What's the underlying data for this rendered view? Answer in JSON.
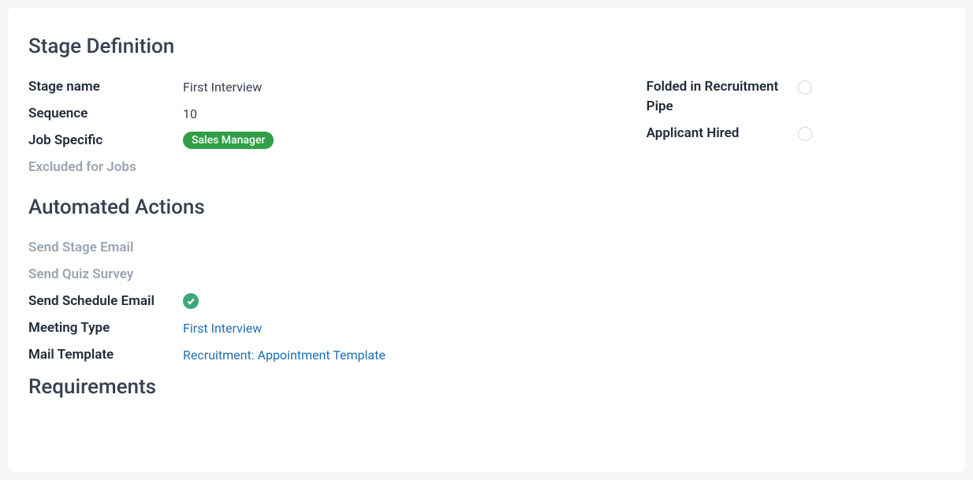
{
  "sections": {
    "stage_definition": {
      "title": "Stage Definition"
    },
    "automated_actions": {
      "title": "Automated Actions"
    },
    "requirements": {
      "title": "Requirements"
    }
  },
  "stage": {
    "name_label": "Stage name",
    "name_value": "First Interview",
    "sequence_label": "Sequence",
    "sequence_value": "10",
    "job_specific_label": "Job Specific",
    "job_specific_tag": "Sales Manager",
    "excluded_jobs_label": "Excluded for Jobs",
    "folded_label": "Folded in Recruitment Pipe",
    "folded_checked": false,
    "hired_label": "Applicant Hired",
    "hired_checked": false
  },
  "automated": {
    "send_stage_email_label": "Send Stage Email",
    "send_quiz_survey_label": "Send Quiz Survey",
    "send_schedule_email_label": "Send Schedule Email",
    "send_schedule_email_checked": true,
    "meeting_type_label": "Meeting Type",
    "meeting_type_value": "First Interview",
    "mail_template_label": "Mail Template",
    "mail_template_value": "Recruitment: Appointment Template"
  }
}
